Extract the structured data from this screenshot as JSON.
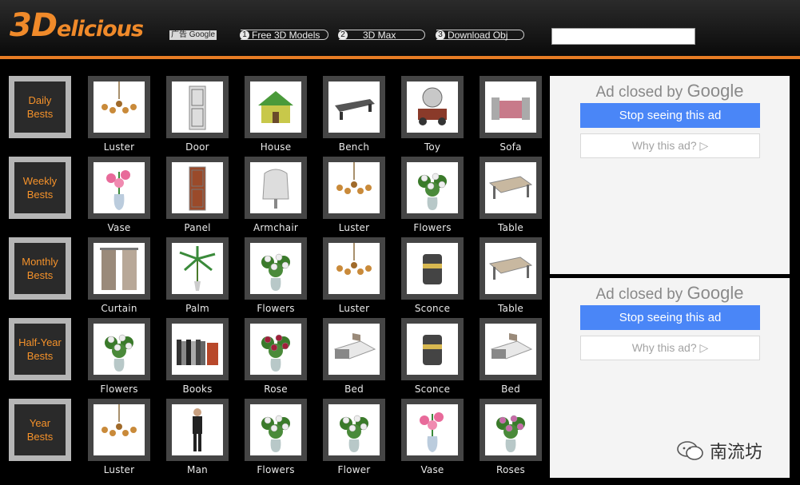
{
  "header": {
    "logo_big": "3D",
    "logo_rest": "elicious",
    "ad_label": "广告 Google",
    "ad_links": [
      {
        "num": "1",
        "label": "Free 3D Models"
      },
      {
        "num": "2",
        "label": "3D Max"
      },
      {
        "num": "3",
        "label": "Download Obj"
      }
    ],
    "search_value": ""
  },
  "categories": [
    {
      "label_line1": "Daily",
      "label_line2": "Bests"
    },
    {
      "label_line1": "Weekly",
      "label_line2": "Bests"
    },
    {
      "label_line1": "Monthly",
      "label_line2": "Bests"
    },
    {
      "label_line1": "Half-Year",
      "label_line2": "Bests"
    },
    {
      "label_line1": "Year",
      "label_line2": "Bests"
    }
  ],
  "rows": [
    [
      "Luster",
      "Door",
      "House",
      "Bench",
      "Toy",
      "Sofa"
    ],
    [
      "Vase",
      "Panel",
      "Armchair",
      "Luster",
      "Flowers",
      "Table"
    ],
    [
      "Curtain",
      "Palm",
      "Flowers",
      "Luster",
      "Sconce",
      "Table"
    ],
    [
      "Flowers",
      "Books",
      "Rose",
      "Bed",
      "Sconce",
      "Bed"
    ],
    [
      "Luster",
      "Man",
      "Flowers",
      "Flower",
      "Vase",
      "Roses"
    ]
  ],
  "ads": [
    {
      "closed_text": "Ad closed by",
      "brand": "Google",
      "stop_label": "Stop seeing this ad",
      "why_label": "Why this ad? ▷"
    },
    {
      "closed_text": "Ad closed by",
      "brand": "Google",
      "stop_label": "Stop seeing this ad",
      "why_label": "Why this ad? ▷"
    }
  ],
  "watermark": "南流坊",
  "colors": {
    "accent": "#e67c24",
    "category_text": "#f5922a",
    "ad_button": "#4a86f7"
  }
}
